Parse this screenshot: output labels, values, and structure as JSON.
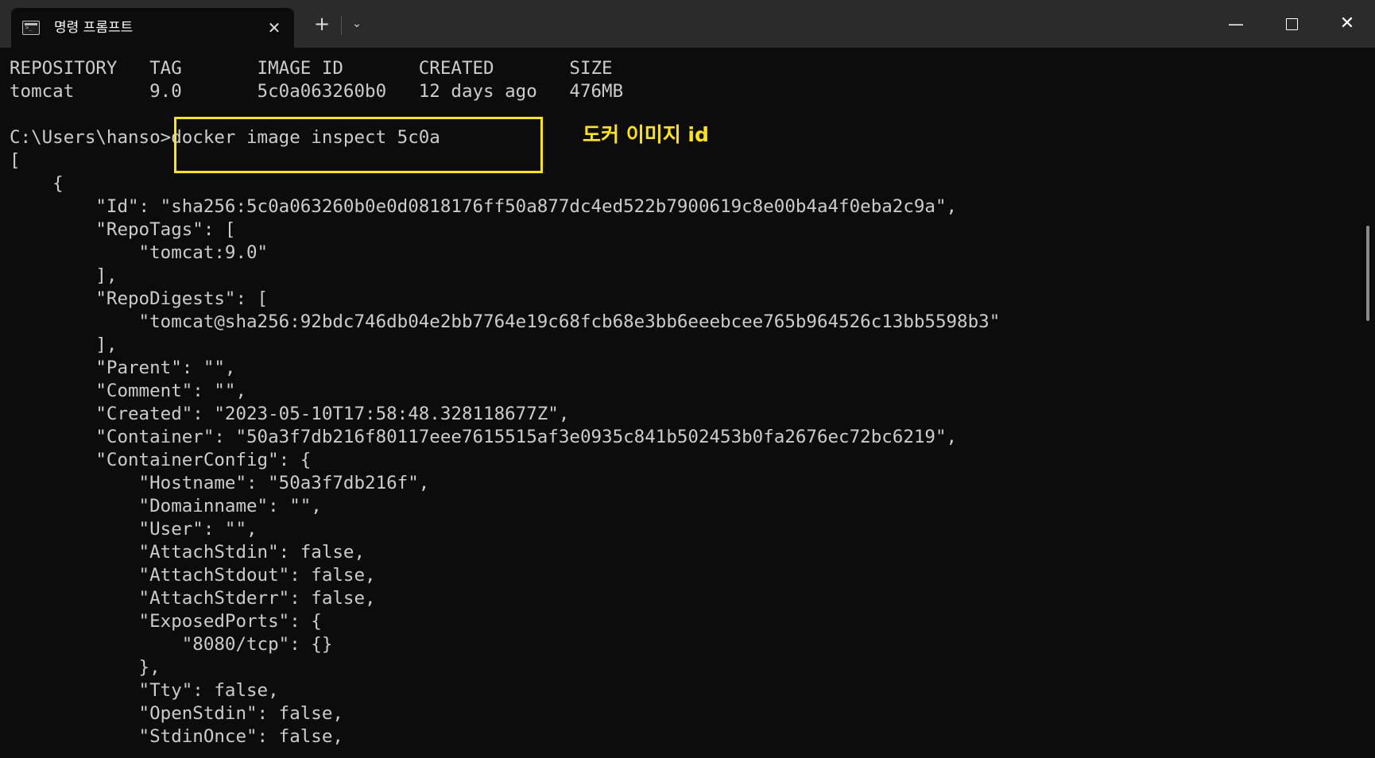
{
  "window": {
    "tab_title": "명령 프롬프트",
    "tab_close_symbol": "✕",
    "new_tab_symbol": "+",
    "dropdown_symbol": "⌄",
    "minimize_symbol": "—",
    "close_symbol": "✕"
  },
  "icons": [
    "terminal-icon",
    "close-icon",
    "plus-icon",
    "chevron-down-icon",
    "minimize-icon",
    "maximize-icon",
    "window-close-icon"
  ],
  "colors": {
    "terminal_bg": "#0c0c0c",
    "terminal_text": "#cccccc",
    "titlebar_bg": "#2b2b2b",
    "annotation": "#ffe600"
  },
  "annotation": {
    "label": "도커 이미지 id"
  },
  "terminal": {
    "lines": [
      "REPOSITORY   TAG       IMAGE ID       CREATED       SIZE",
      "tomcat       9.0       5c0a063260b0   12 days ago   476MB",
      "",
      "C:\\Users\\hanso>docker image inspect 5c0a",
      "[",
      "    {",
      "        \"Id\": \"sha256:5c0a063260b0e0d0818176ff50a877dc4ed522b7900619c8e00b4a4f0eba2c9a\",",
      "        \"RepoTags\": [",
      "            \"tomcat:9.0\"",
      "        ],",
      "        \"RepoDigests\": [",
      "            \"tomcat@sha256:92bdc746db04e2bb7764e19c68fcb68e3bb6eeebcee765b964526c13bb5598b3\"",
      "        ],",
      "        \"Parent\": \"\",",
      "        \"Comment\": \"\",",
      "        \"Created\": \"2023-05-10T17:58:48.328118677Z\",",
      "        \"Container\": \"50a3f7db216f80117eee7615515af3e0935c841b502453b0fa2676ec72bc6219\",",
      "        \"ContainerConfig\": {",
      "            \"Hostname\": \"50a3f7db216f\",",
      "            \"Domainname\": \"\",",
      "            \"User\": \"\",",
      "            \"AttachStdin\": false,",
      "            \"AttachStdout\": false,",
      "            \"AttachStderr\": false,",
      "            \"ExposedPorts\": {",
      "                \"8080/tcp\": {}",
      "            },",
      "            \"Tty\": false,",
      "            \"OpenStdin\": false,",
      "            \"StdinOnce\": false,"
    ]
  }
}
